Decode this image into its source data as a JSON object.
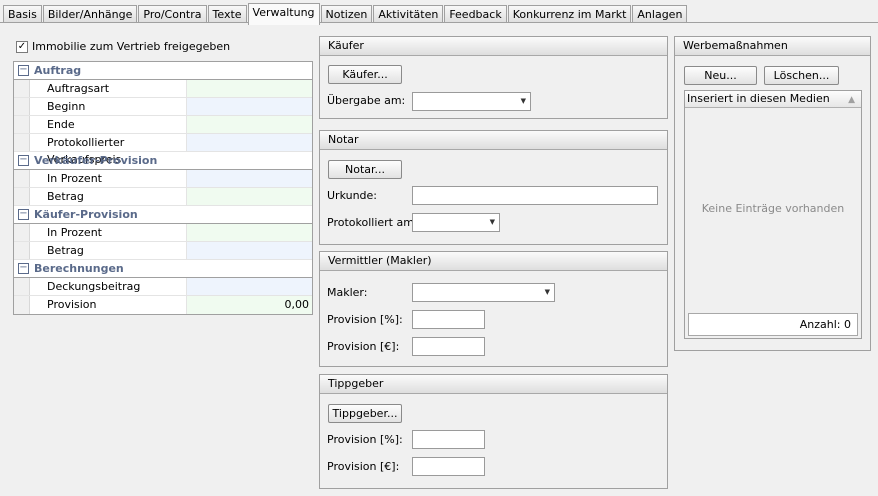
{
  "tabs": [
    "Basis",
    "Bilder/Anhänge",
    "Pro/Contra",
    "Texte",
    "Verwaltung",
    "Notizen",
    "Aktivitäten",
    "Feedback",
    "Konkurrenz im Markt",
    "Anlagen"
  ],
  "active_tab": "Verwaltung",
  "checkbox": {
    "label": "Immobilie zum Vertrieb freigegeben",
    "checked": true,
    "mark": "✓"
  },
  "grid": {
    "expander": "−",
    "auftrag": {
      "title": "Auftrag",
      "r0": "Auftragsart",
      "r1": "Beginn",
      "r2": "Ende",
      "r3": "Protokollierter Verkaufspreis"
    },
    "verkaeufer": {
      "title": "Verkäufer-Provision",
      "r0": "In Prozent",
      "r1": "Betrag"
    },
    "kaeufer": {
      "title": "Käufer-Provision",
      "r0": "In Prozent",
      "r1": "Betrag"
    },
    "berechnungen": {
      "title": "Berechnungen",
      "r0": "Deckungsbeitrag",
      "r1": "Provision",
      "r1_value": "0,00"
    }
  },
  "kaeufer_panel": {
    "title": "Käufer",
    "button": "Käufer...",
    "uebergabe_label": "Übergabe am:"
  },
  "notar_panel": {
    "title": "Notar",
    "button": "Notar...",
    "urkunde_label": "Urkunde:",
    "protokolliert_label": "Protokolliert am:"
  },
  "vermittler_panel": {
    "title": "Vermittler (Makler)",
    "makler_label": "Makler:",
    "prov_pct_label": "Provision [%]:",
    "prov_eur_label": "Provision [€]:"
  },
  "tippgeber_panel": {
    "title": "Tippgeber",
    "button": "Tippgeber...",
    "prov_pct_label": "Provision [%]:",
    "prov_eur_label": "Provision [€]:"
  },
  "werbe_panel": {
    "title": "Werbemaßnahmen",
    "new_button": "Neu...",
    "delete_button": "Löschen...",
    "column_header": "Inseriert in diesen Medien",
    "empty_text": "Keine Einträge vorhanden",
    "count": "Anzahl: 0"
  }
}
